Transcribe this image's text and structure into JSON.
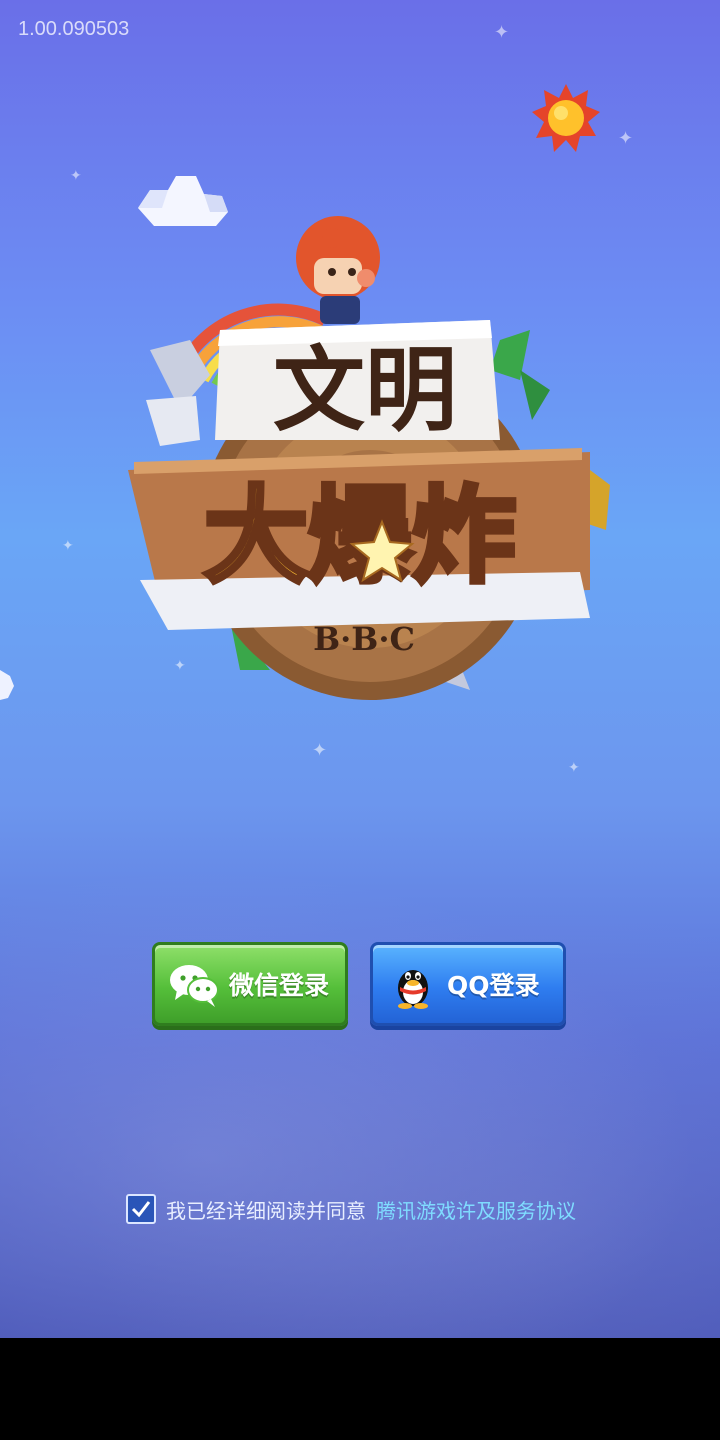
{
  "version": "1.00.090503",
  "logo": {
    "title_line1": "文明",
    "title_line2": "大爆炸",
    "subtitle": "B·B·C"
  },
  "login": {
    "wechat_label": "微信登录",
    "qq_label": "QQ登录"
  },
  "agreement": {
    "checked": true,
    "text": "我已经详细阅读并同意",
    "link_text": "腾讯游戏许及服务协议"
  },
  "colors": {
    "wechat_green": "#55bf3a",
    "qq_blue": "#2f7df0",
    "link": "#7fdcff"
  }
}
